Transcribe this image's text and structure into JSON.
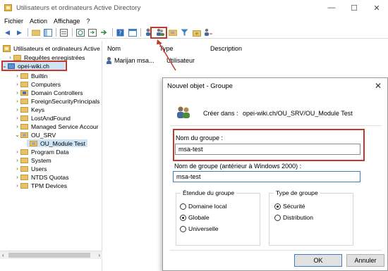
{
  "window": {
    "title": "Utilisateurs et ordinateurs Active Directory",
    "minimize": "—",
    "maximize": "☐",
    "close": "✕"
  },
  "menu": [
    "Fichier",
    "Action",
    "Affichage",
    "?"
  ],
  "tree": {
    "root": "Utilisateurs et ordinateurs Active",
    "saved_queries": "Requêtes enregistrées",
    "domain": "opei-wiki.ch",
    "items": [
      "Builtin",
      "Computers",
      "Domain Controllers",
      "ForeignSecurityPrincipals",
      "Keys",
      "LostAndFound",
      "Managed Service Accour",
      "OU_SRV"
    ],
    "ou_child": "OU_Module Test",
    "items_after": [
      "Program Data",
      "System",
      "Users",
      "NTDS Quotas",
      "TPM Devices"
    ]
  },
  "list": {
    "columns": [
      "Nom",
      "Type",
      "Description"
    ],
    "rows": [
      {
        "name": "Marijan msa...",
        "type": "Utilisateur",
        "description": ""
      }
    ]
  },
  "dialog": {
    "title": "Nouvel objet - Groupe",
    "close": "✕",
    "create_in_label": "Créer dans :",
    "create_in_path": "opei-wiki.ch/OU_SRV/OU_Module Test",
    "group_name_label": "Nom du groupe :",
    "group_name_value": "msa-test",
    "group_name_legacy_label": "Nom de groupe (antérieur à Windows 2000) :",
    "group_name_legacy_value": "msa-test",
    "scope": {
      "title": "Étendue du groupe",
      "options": [
        "Domaine local",
        "Globale",
        "Universelle"
      ],
      "selected": "Globale"
    },
    "type": {
      "title": "Type de groupe",
      "options": [
        "Sécurité",
        "Distribution"
      ],
      "selected": "Sécurité"
    },
    "ok": "OK",
    "cancel": "Annuler"
  },
  "colors": {
    "highlight_red": "#c0392b",
    "focus_blue": "#3c7fc4",
    "selection": "#cde4f7"
  }
}
